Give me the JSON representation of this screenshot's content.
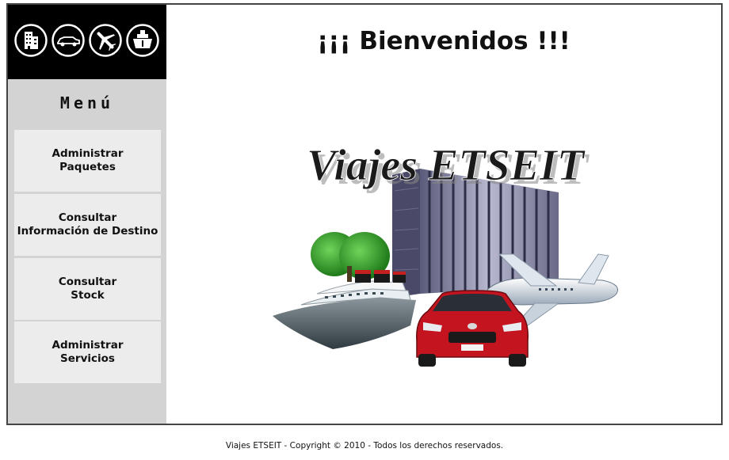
{
  "header": {
    "icons": [
      "building-icon",
      "car-icon",
      "airplane-icon",
      "ship-icon"
    ]
  },
  "sidebar": {
    "menu_title": "Menú",
    "items": [
      {
        "label": "Administrar\nPaquetes"
      },
      {
        "label": "Consultar\nInformación de Destino"
      },
      {
        "label": "Consultar\nStock"
      },
      {
        "label": "Administrar\nServicios"
      }
    ]
  },
  "main": {
    "welcome": "¡¡¡ Bienvenidos !!!",
    "hero_title": "Viajes ETSEIT"
  },
  "footer": {
    "text": "Viajes ETSEIT - Copyright © 2010 - Todos los derechos reservados."
  },
  "colors": {
    "sidebar_bg": "#d3d3d3",
    "button_bg": "#ececec",
    "logo_bar_bg": "#000000",
    "car_red": "#c41420"
  }
}
